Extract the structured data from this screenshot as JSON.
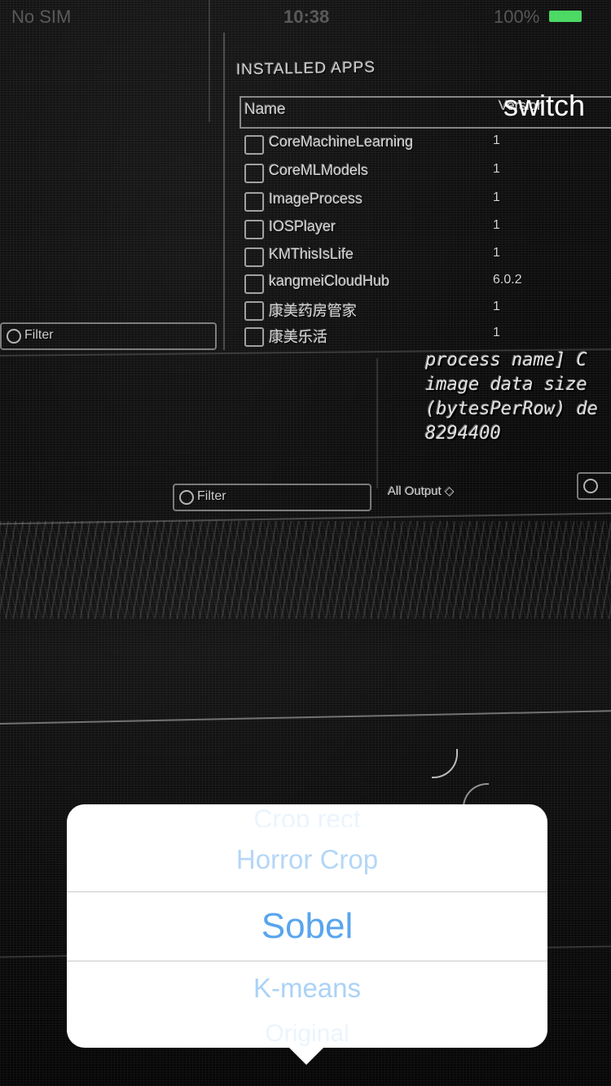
{
  "status_bar": {
    "carrier": "No SIM",
    "time": "10:38",
    "battery_percent": "100%",
    "battery_color": "#4cd964"
  },
  "switch_button": {
    "label": "switch"
  },
  "background_scene": {
    "installed_apps_title": "INSTALLED APPS",
    "columns": {
      "name": "Name",
      "version": "Version"
    },
    "apps": [
      {
        "name": "CoreMachineLearning",
        "version": "1"
      },
      {
        "name": "CoreMLModels",
        "version": "1"
      },
      {
        "name": "ImageProcess",
        "version": "1"
      },
      {
        "name": "IOSPlayer",
        "version": "1"
      },
      {
        "name": "KMThisIsLife",
        "version": "1"
      },
      {
        "name": "kangmeiCloudHub",
        "version": "6.0.2"
      },
      {
        "name": "康美药房管家",
        "version": "1"
      },
      {
        "name": "康美乐活",
        "version": "1"
      }
    ],
    "filter_left": "Filter",
    "filter_center": "Filter",
    "output_selector": "All Output ◇",
    "console_lines": [
      "process name] C",
      "image data size",
      "(bytesPerRow) de",
      "8294400"
    ]
  },
  "filter_picker": {
    "options": [
      "Crop rect",
      "Horror Crop",
      "Sobel",
      "K-means",
      "Original"
    ],
    "selected": "Sobel",
    "accent_color": "#58a5ee"
  }
}
